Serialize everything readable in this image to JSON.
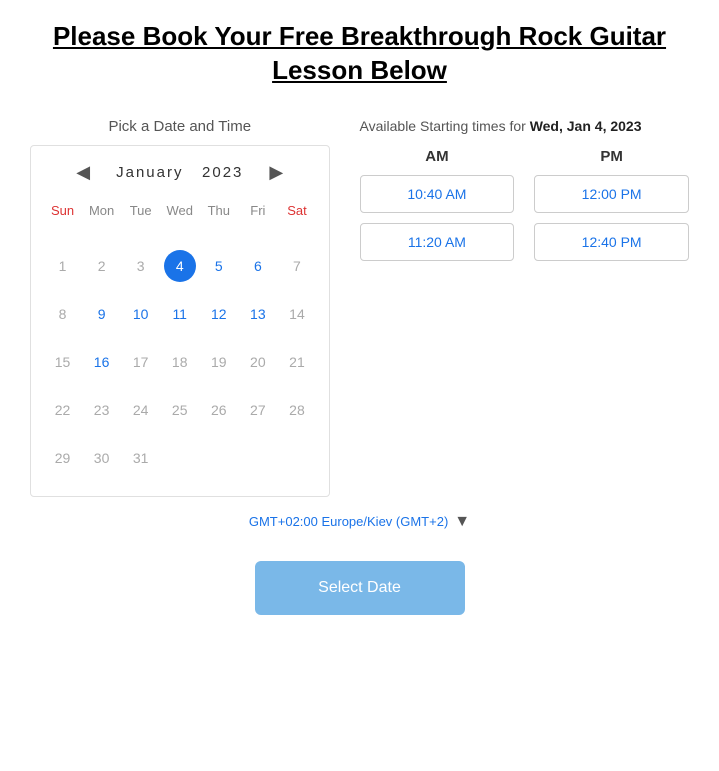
{
  "title": "Please Book Your Free Breakthrough Rock Guitar Lesson Below",
  "calendar": {
    "label": "Pick a Date and Time",
    "month": "January",
    "year": "2023",
    "days_header": [
      "Sun",
      "Mon",
      "Tue",
      "Wed",
      "Thu",
      "Fri",
      "Sat"
    ],
    "weeks": [
      [
        null,
        null,
        null,
        null,
        null,
        null,
        null
      ],
      [
        1,
        2,
        3,
        4,
        5,
        6,
        7
      ],
      [
        8,
        9,
        10,
        11,
        12,
        13,
        14
      ],
      [
        15,
        16,
        17,
        18,
        19,
        20,
        21
      ],
      [
        22,
        23,
        24,
        25,
        26,
        27,
        28
      ],
      [
        29,
        30,
        31,
        null,
        null,
        null,
        null
      ]
    ],
    "selected_day": 4,
    "available_days": [
      4,
      5,
      6,
      9,
      10,
      11,
      12,
      13,
      16
    ]
  },
  "timeslots": {
    "header_text": "Available Starting times for ",
    "header_date": "Wed, Jan 4, 2023",
    "am_label": "AM",
    "pm_label": "PM",
    "am_slots": [
      "10:40 AM",
      "11:20 AM"
    ],
    "pm_slots": [
      "12:00 PM",
      "12:40 PM"
    ]
  },
  "timezone": {
    "label": "GMT+02:00 Europe/Kiev (GMT+2)"
  },
  "select_button": {
    "label": "Select Date"
  }
}
